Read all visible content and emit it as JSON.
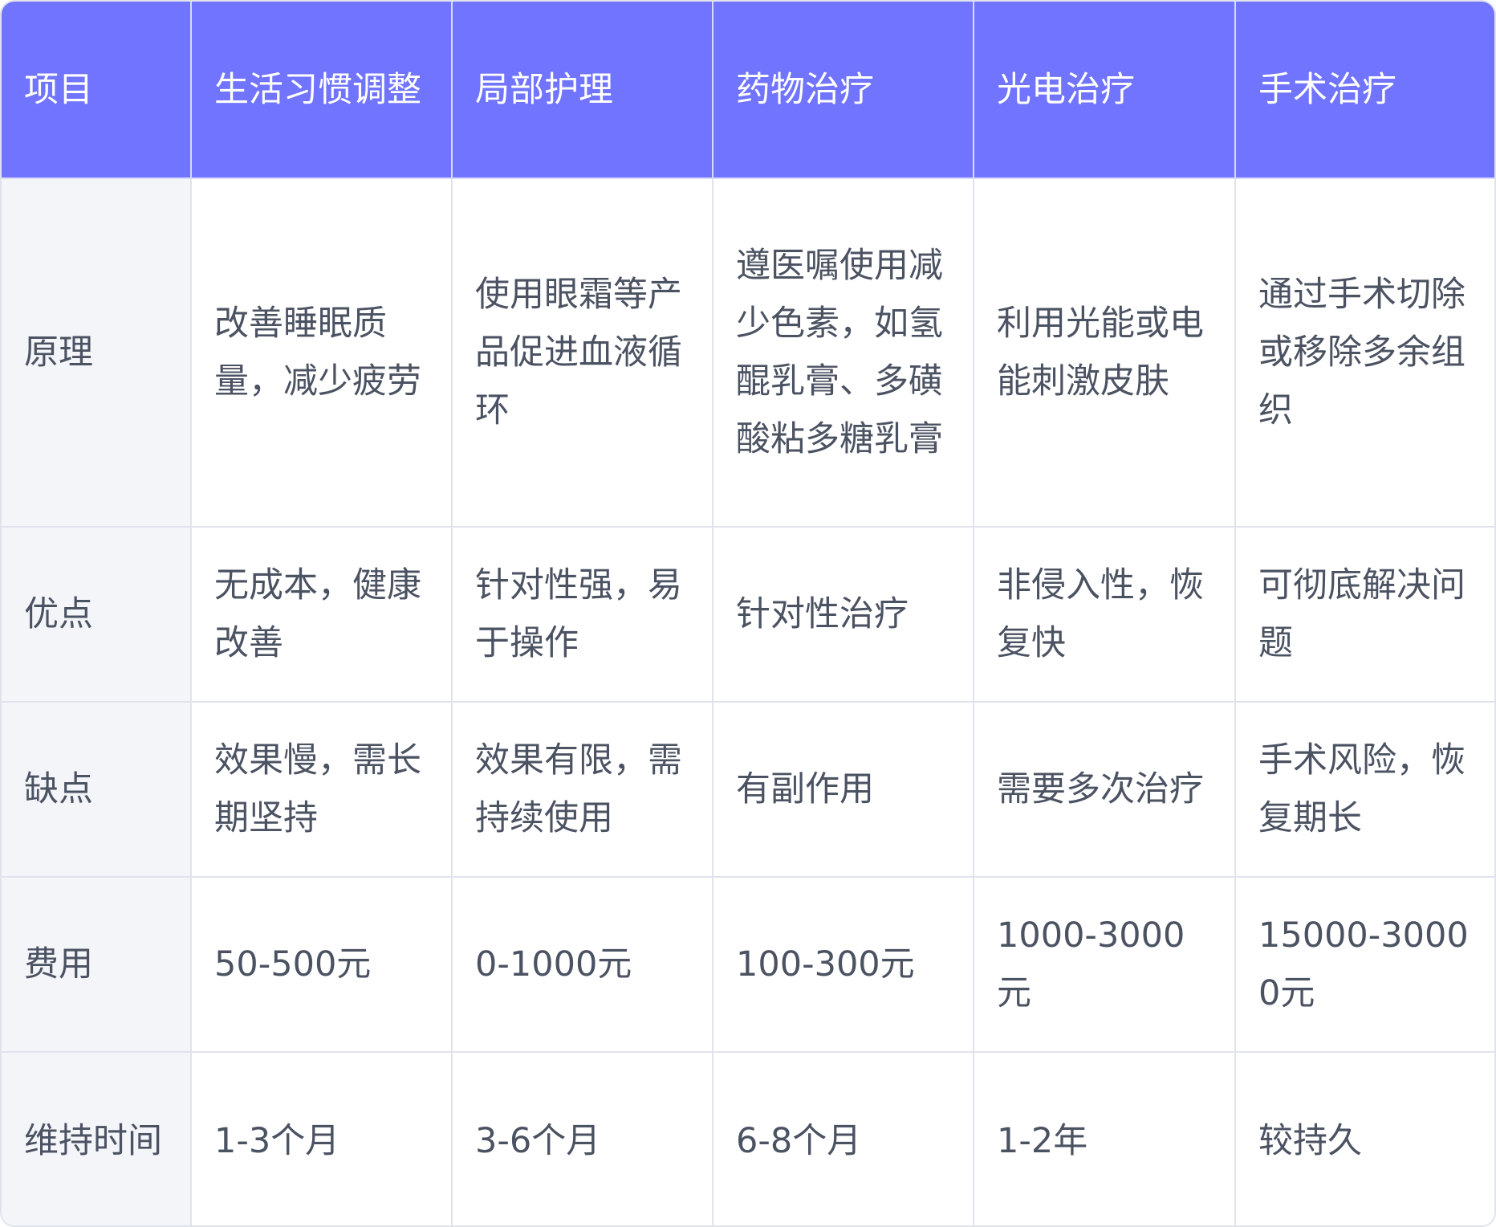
{
  "table": {
    "columns": [
      "项目",
      "生活习惯调整",
      "局部护理",
      "药物治疗",
      "光电治疗",
      "手术治疗"
    ],
    "rows": [
      {
        "label": "原理",
        "cells": [
          "改善睡眠质量，减少疲劳",
          "使用眼霜等产品促进血液循环",
          "遵医嘱使用减少色素，如氢醌乳膏、多磺酸粘多糖乳膏",
          "利用光能或电能刺激皮肤",
          "通过手术切除或移除多余组织"
        ]
      },
      {
        "label": "优点",
        "cells": [
          "无成本，健康改善",
          "针对性强，易于操作",
          "针对性治疗",
          "非侵入性，恢复快",
          "可彻底解决问题"
        ]
      },
      {
        "label": "缺点",
        "cells": [
          "效果慢，需长期坚持",
          "效果有限，需持续使用",
          "有副作用",
          "需要多次治疗",
          "手术风险，恢复期长"
        ]
      },
      {
        "label": "费用",
        "cells": [
          "50-500元",
          "0-1000元",
          "100-300元",
          "1000-3000元",
          "15000-30000元"
        ]
      },
      {
        "label": "维持时间",
        "cells": [
          "1-3个月",
          "3-6个月",
          "6-8个月",
          "1-2年",
          "较持久"
        ]
      }
    ]
  },
  "colors": {
    "header_bg": "#7074ff",
    "header_text": "#ffffff",
    "row_label_bg": "#f4f5f9",
    "body_text": "#4b5262",
    "border": "#e1e3ec"
  }
}
